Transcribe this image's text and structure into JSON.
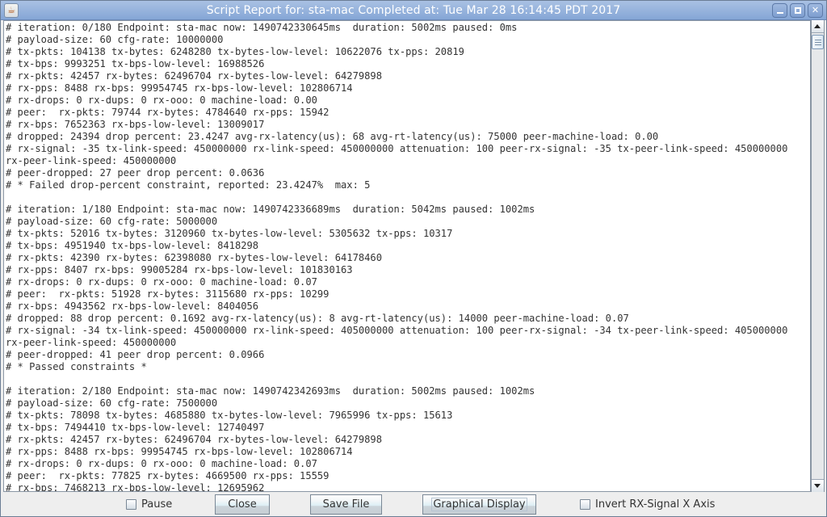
{
  "window": {
    "title": "Script Report for:  sta-mac Completed at: Tue Mar 28 16:14:45 PDT 2017",
    "app_icon": "java-cup-icon",
    "controls": [
      "minimize",
      "maximize",
      "close"
    ]
  },
  "report": {
    "lines": [
      "# iteration: 0/180 Endpoint: sta-mac now: 1490742330645ms  duration: 5002ms paused: 0ms",
      "# payload-size: 60 cfg-rate: 10000000",
      "# tx-pkts: 104138 tx-bytes: 6248280 tx-bytes-low-level: 10622076 tx-pps: 20819",
      "# tx-bps: 9993251 tx-bps-low-level: 16988526",
      "# rx-pkts: 42457 rx-bytes: 62496704 rx-bytes-low-level: 64279898",
      "# rx-pps: 8488 rx-bps: 99954745 rx-bps-low-level: 102806714",
      "# rx-drops: 0 rx-dups: 0 rx-ooo: 0 machine-load: 0.00",
      "# peer:  rx-pkts: 79744 rx-bytes: 4784640 rx-pps: 15942",
      "# rx-bps: 7652363 rx-bps-low-level: 13009017",
      "# dropped: 24394 drop percent: 23.4247 avg-rx-latency(us): 68 avg-rt-latency(us): 75000 peer-machine-load: 0.00",
      "# rx-signal: -35 tx-link-speed: 450000000 rx-link-speed: 450000000 attenuation: 100 peer-rx-signal: -35 tx-peer-link-speed: 450000000",
      "rx-peer-link-speed: 450000000",
      "# peer-dropped: 27 peer drop percent: 0.0636",
      "# * Failed drop-percent constraint, reported: 23.4247%  max: 5",
      "",
      "# iteration: 1/180 Endpoint: sta-mac now: 1490742336689ms  duration: 5042ms paused: 1002ms",
      "# payload-size: 60 cfg-rate: 5000000",
      "# tx-pkts: 52016 tx-bytes: 3120960 tx-bytes-low-level: 5305632 tx-pps: 10317",
      "# tx-bps: 4951940 tx-bps-low-level: 8418298",
      "# rx-pkts: 42390 rx-bytes: 62398080 rx-bytes-low-level: 64178460",
      "# rx-pps: 8407 rx-bps: 99005284 rx-bps-low-level: 101830163",
      "# rx-drops: 0 rx-dups: 0 rx-ooo: 0 machine-load: 0.07",
      "# peer:  rx-pkts: 51928 rx-bytes: 3115680 rx-pps: 10299",
      "# rx-bps: 4943562 rx-bps-low-level: 8404056",
      "# dropped: 88 drop percent: 0.1692 avg-rx-latency(us): 8 avg-rt-latency(us): 14000 peer-machine-load: 0.07",
      "# rx-signal: -34 tx-link-speed: 450000000 rx-link-speed: 405000000 attenuation: 100 peer-rx-signal: -34 tx-peer-link-speed: 405000000",
      "rx-peer-link-speed: 450000000",
      "# peer-dropped: 41 peer drop percent: 0.0966",
      "# * Passed constraints *",
      "",
      "# iteration: 2/180 Endpoint: sta-mac now: 1490742342693ms  duration: 5002ms paused: 1002ms",
      "# payload-size: 60 cfg-rate: 7500000",
      "# tx-pkts: 78098 tx-bytes: 4685880 tx-bytes-low-level: 7965996 tx-pps: 15613",
      "# tx-bps: 7494410 tx-bps-low-level: 12740497",
      "# rx-pkts: 42457 rx-bytes: 62496704 rx-bytes-low-level: 64279898",
      "# rx-pps: 8488 rx-bps: 99954745 rx-bps-low-level: 102806714",
      "# rx-drops: 0 rx-dups: 0 rx-ooo: 0 machine-load: 0.07",
      "# peer:  rx-pkts: 77825 rx-bytes: 4669500 rx-pps: 15559",
      "# rx-bps: 7468213 rx-bps-low-level: 12695962"
    ]
  },
  "scrollbar": {
    "position_fraction": 0.0
  },
  "footer": {
    "pause_label": "Pause",
    "pause_checked": false,
    "close_label": "Close",
    "save_label": "Save File",
    "graph_label": "Graphical Display",
    "invert_label": "Invert RX-Signal X Axis",
    "invert_checked": false
  }
}
